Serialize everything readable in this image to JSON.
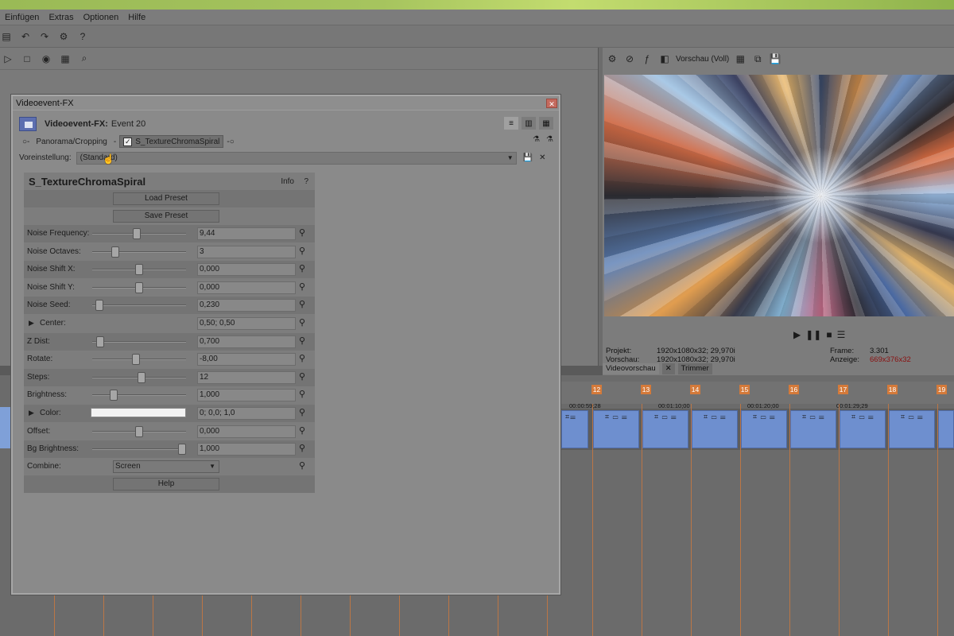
{
  "menu": [
    "Einfügen",
    "Extras",
    "Optionen",
    "Hilfe"
  ],
  "preview": {
    "quality_label": "Vorschau (Voll)",
    "info": {
      "projekt_label": "Projekt:",
      "projekt_value": "1920x1080x32; 29,970i",
      "vorschau_label": "Vorschau:",
      "vorschau_value": "1920x1080x32; 29,970i",
      "frame_label": "Frame:",
      "frame_value": "3.301",
      "anzeige_label": "Anzeige:",
      "anzeige_value": "669x376x32"
    },
    "tabs": [
      "Videovorschau",
      "Trimmer"
    ]
  },
  "timeline": {
    "markers": [
      "12",
      "13",
      "14",
      "15",
      "16",
      "17",
      "18",
      "19"
    ],
    "timecodes": [
      "00:00:59;28",
      "00:01:10;00",
      "00:01:20;00",
      "00:01:29;29"
    ]
  },
  "dialog": {
    "title": "Videoevent-FX",
    "header_bold": "Videoevent-FX:",
    "header_event": "Event 20",
    "chain_item_1": "Panorama/Cropping",
    "chain_item_2": "S_TextureChromaSpiral",
    "preset_label": "Voreinstellung:",
    "preset_value": "(Standard)"
  },
  "plugin": {
    "name": "S_TextureChromaSpiral",
    "info": "Info",
    "help_q": "?",
    "load_preset": "Load Preset",
    "save_preset": "Save Preset",
    "params": [
      {
        "label": "Noise Frequency:",
        "value": "9,44",
        "pos": 0.47
      },
      {
        "label": "Noise Octaves:",
        "value": "3",
        "pos": 0.22
      },
      {
        "label": "Noise Shift X:",
        "value": "0,000",
        "pos": 0.5
      },
      {
        "label": "Noise Shift Y:",
        "value": "0,000",
        "pos": 0.5
      },
      {
        "label": "Noise Seed:",
        "value": "0,230",
        "pos": 0.04
      },
      {
        "label": "Center:",
        "value": "0,50; 0,50"
      },
      {
        "label": "Z Dist:",
        "value": "0,700",
        "pos": 0.05
      },
      {
        "label": "Rotate:",
        "value": "-8,00",
        "pos": 0.46
      },
      {
        "label": "Steps:",
        "value": "12",
        "pos": 0.53
      },
      {
        "label": "Brightness:",
        "value": "1,000",
        "pos": 0.2
      },
      {
        "label": "Color:",
        "value": "0; 0,0; 1,0"
      },
      {
        "label": "Offset:",
        "value": "0,000",
        "pos": 0.5
      },
      {
        "label": "Bg Brightness:",
        "value": "1,000",
        "pos": 1.0
      }
    ],
    "combine_label": "Combine:",
    "combine_value": "Screen",
    "help_button": "Help"
  }
}
